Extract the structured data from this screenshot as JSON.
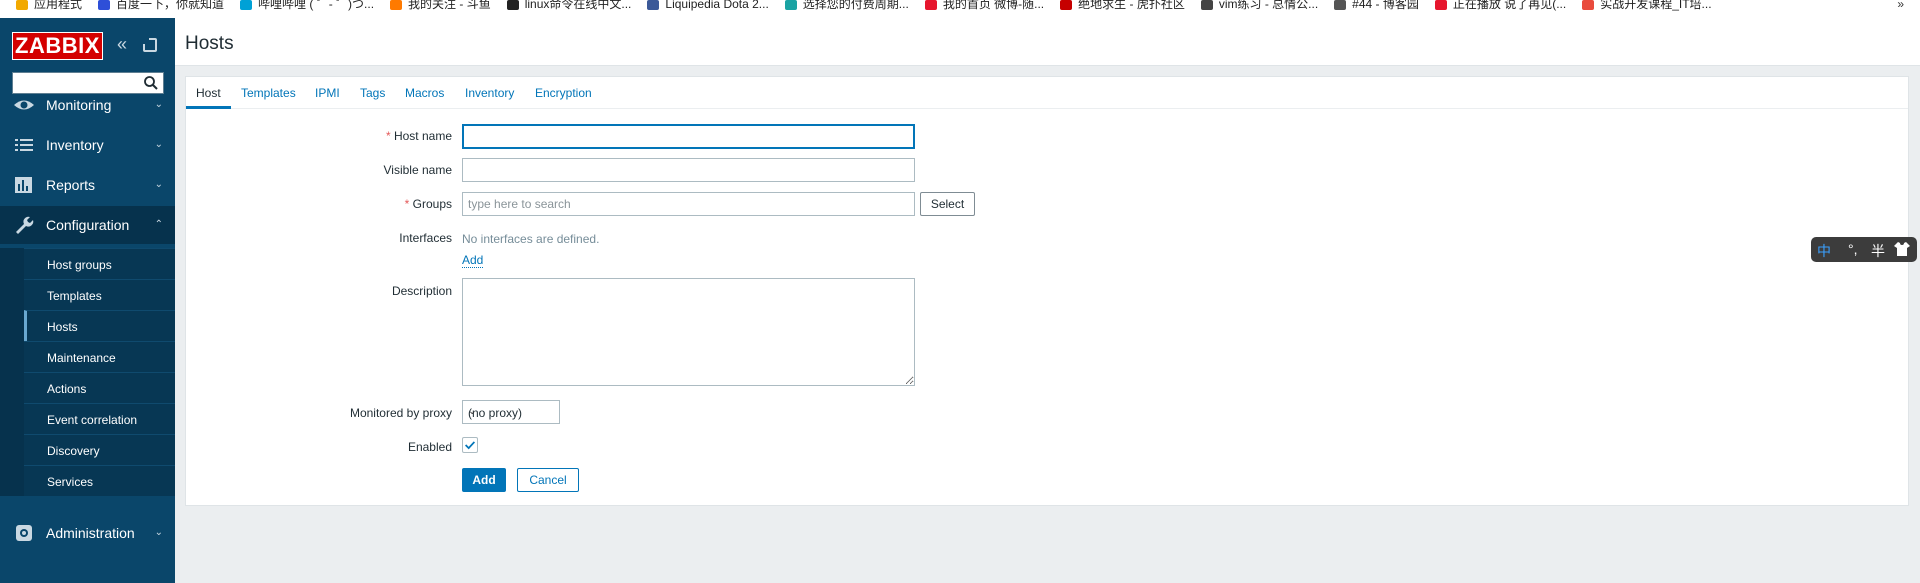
{
  "bookmarks": {
    "items": [
      {
        "label": "应用程式",
        "color": "#f2a900"
      },
      {
        "label": "百度一下，你就知道",
        "color": "#2e4fd8"
      },
      {
        "label": "哔哩哔哩 ( ゜- ゜)つ...",
        "color": "#00a1d6"
      },
      {
        "label": "我的关注 - 斗鱼",
        "color": "#ff7a00"
      },
      {
        "label": "linux命令在线中文...",
        "color": "#222222"
      },
      {
        "label": "Liquipedia Dota 2...",
        "color": "#3b5998"
      },
      {
        "label": "选择您的付费周期...",
        "color": "#1aa3a3"
      },
      {
        "label": "我的首页 微博-随...",
        "color": "#e6162d"
      },
      {
        "label": "绝地求生 - 虎扑社区",
        "color": "#c60000"
      },
      {
        "label": "vim练习 - 总情公...",
        "color": "#444444"
      },
      {
        "label": "#44 - 博客园",
        "color": "#555555"
      },
      {
        "label": "正在播放 说了再见(...",
        "color": "#e6162d"
      },
      {
        "label": "实战开发课程_IT培...",
        "color": "#e94b3c"
      }
    ],
    "more": "»"
  },
  "sidebar": {
    "logo": "ZABBIX",
    "collapse_glyph": "«",
    "search": {
      "value": "",
      "placeholder": ""
    },
    "menu": {
      "monitoring": "Monitoring",
      "inventory": "Inventory",
      "reports": "Reports",
      "configuration": "Configuration",
      "administration": "Administration"
    },
    "chevron_down": "⌄",
    "chevron_up": "⌃",
    "submenu": [
      {
        "label": "Host groups"
      },
      {
        "label": "Templates"
      },
      {
        "label": "Hosts",
        "active": true
      },
      {
        "label": "Maintenance"
      },
      {
        "label": "Actions"
      },
      {
        "label": "Event correlation"
      },
      {
        "label": "Discovery"
      },
      {
        "label": "Services"
      }
    ]
  },
  "page": {
    "title": "Hosts"
  },
  "tabs": [
    {
      "label": "Host",
      "active": true
    },
    {
      "label": "Templates"
    },
    {
      "label": "IPMI"
    },
    {
      "label": "Tags"
    },
    {
      "label": "Macros"
    },
    {
      "label": "Inventory"
    },
    {
      "label": "Encryption"
    }
  ],
  "form": {
    "required_mark": "*",
    "host_name": {
      "label": "Host name",
      "value": ""
    },
    "visible_name": {
      "label": "Visible name",
      "value": ""
    },
    "groups": {
      "label": "Groups",
      "placeholder": "type here to search",
      "select_label": "Select"
    },
    "interfaces": {
      "label": "Interfaces",
      "empty_text": "No interfaces are defined.",
      "add_label": "Add"
    },
    "description": {
      "label": "Description",
      "value": ""
    },
    "proxy": {
      "label": "Monitored by proxy",
      "selected": "(no proxy)"
    },
    "enabled": {
      "label": "Enabled",
      "checked": true
    },
    "add_button": "Add",
    "cancel_button": "Cancel"
  },
  "ime": {
    "lang": "中",
    "punct": "°,",
    "width": "半"
  },
  "colors": {
    "sidebar": "#0a466a",
    "sidebar_active": "#06324d",
    "accent": "#0275b8",
    "logo_red": "#d40000",
    "required": "#e45959"
  }
}
